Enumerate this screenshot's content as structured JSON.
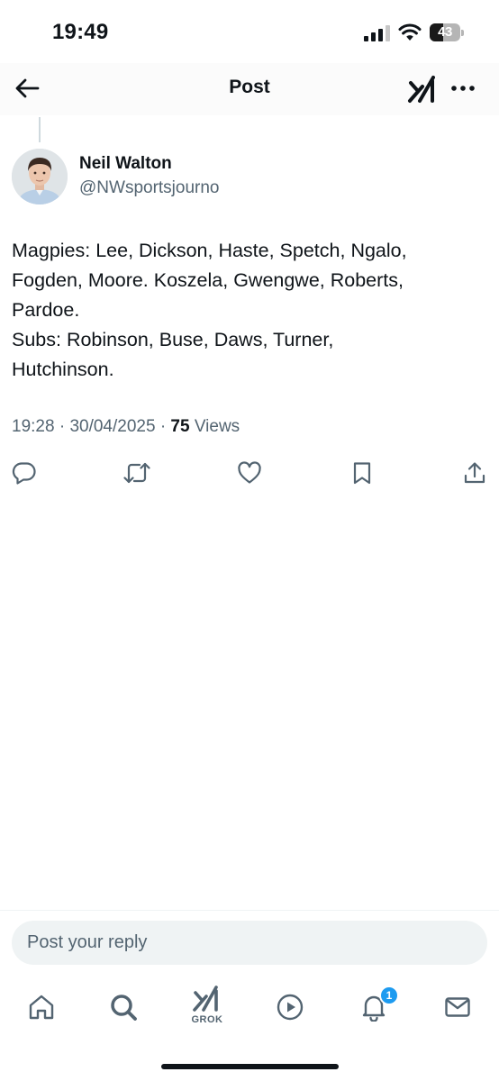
{
  "status_bar": {
    "time": "19:49",
    "battery_level": "43",
    "battery_fraction": 0.43
  },
  "header": {
    "title": "Post",
    "icons": {
      "back": "back-arrow-icon",
      "grok": "grok-icon",
      "more": "more-dots-icon"
    }
  },
  "post": {
    "author": {
      "name": "Neil Walton",
      "handle": "@NWsportsjourno"
    },
    "body_lines": [
      "Magpies: Lee, Dickson, Haste, Spetch, Ngalo,",
      "Fogden, Moore. Koszela, Gwengwe, Roberts,",
      "Pardoe.",
      "Subs: Robinson, Buse, Daws, Turner,",
      "Hutchinson."
    ],
    "time": "19:28",
    "date": "30/04/2025",
    "separator": "·",
    "views_count": "75",
    "views_label": "Views",
    "actions": [
      "reply-icon",
      "repost-icon",
      "like-icon",
      "bookmark-icon",
      "share-icon"
    ]
  },
  "reply": {
    "placeholder": "Post your reply"
  },
  "tab_bar": {
    "items": [
      "home-icon",
      "search-icon",
      "grok-icon",
      "video-icon",
      "notifications-icon",
      "messages-icon"
    ],
    "grok_label": "GROK",
    "notification_badge": "1"
  },
  "colors": {
    "text_primary": "#0f1419",
    "text_secondary": "#536471",
    "accent": "#1d9bf0",
    "divider": "#eff3f4"
  }
}
